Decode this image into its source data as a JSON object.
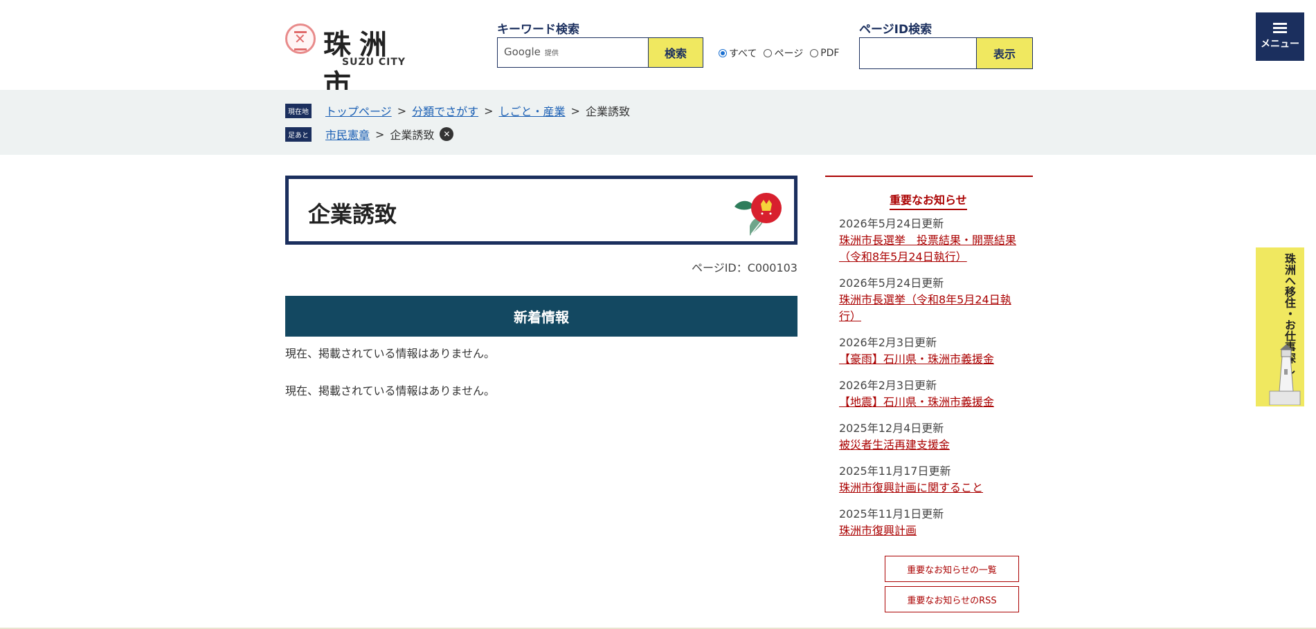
{
  "header": {
    "logo_kanji": "珠洲市",
    "logo_en": "SUZU CITY",
    "keyword_label": "キーワード検索",
    "google_text": "Google",
    "google_sub": "提供",
    "search_button": "検索",
    "radios": [
      {
        "label": "すべて",
        "selected": true
      },
      {
        "label": "ページ",
        "selected": false
      },
      {
        "label": "PDF",
        "selected": false
      }
    ],
    "pageid_label": "ページID検索",
    "pageid_button": "表示",
    "menu_label": "メニュー"
  },
  "breadcrumb": {
    "current_tag": "現在地",
    "current": [
      "トップページ",
      "分類でさがす",
      "しごと・産業"
    ],
    "current_last": "企業誘致",
    "history_tag": "足あと",
    "history": [
      "市民憲章"
    ],
    "history_last": "企業誘致",
    "separator": ">"
  },
  "main": {
    "title": "企業誘致",
    "page_id": "ページID：C000103",
    "new_info_heading": "新着情報",
    "no_info_1": "現在、掲載されている情報はありません。",
    "no_info_2": "現在、掲載されている情報はありません。"
  },
  "sidebar": {
    "heading": "重要なお知らせ",
    "news": [
      {
        "date": "2026年5月24日更新",
        "title": "珠洲市長選挙　投票結果・開票結果（令和8年5月24日執行）"
      },
      {
        "date": "2026年5月24日更新",
        "title": "珠洲市長選挙（令和8年5月24日執行）"
      },
      {
        "date": "2026年2月3日更新",
        "title": "【豪雨】石川県・珠洲市義援金"
      },
      {
        "date": "2026年2月3日更新",
        "title": "【地震】石川県・珠洲市義援金"
      },
      {
        "date": "2025年12月4日更新",
        "title": "被災者生活再建支援金"
      },
      {
        "date": "2025年11月17日更新",
        "title": "珠洲市復興計画に関すること"
      },
      {
        "date": "2025年11月1日更新",
        "title": "珠洲市復興計画"
      }
    ],
    "list_button": "重要なお知らせの一覧",
    "rss_button": "重要なお知らせのRSS"
  },
  "side_tab": {
    "text": "珠洲へ移住・お仕事探し"
  },
  "colors": {
    "navy": "#1b2f5e",
    "teal": "#134861",
    "yellow": "#f0e860",
    "alert_red": "#aa0000"
  }
}
